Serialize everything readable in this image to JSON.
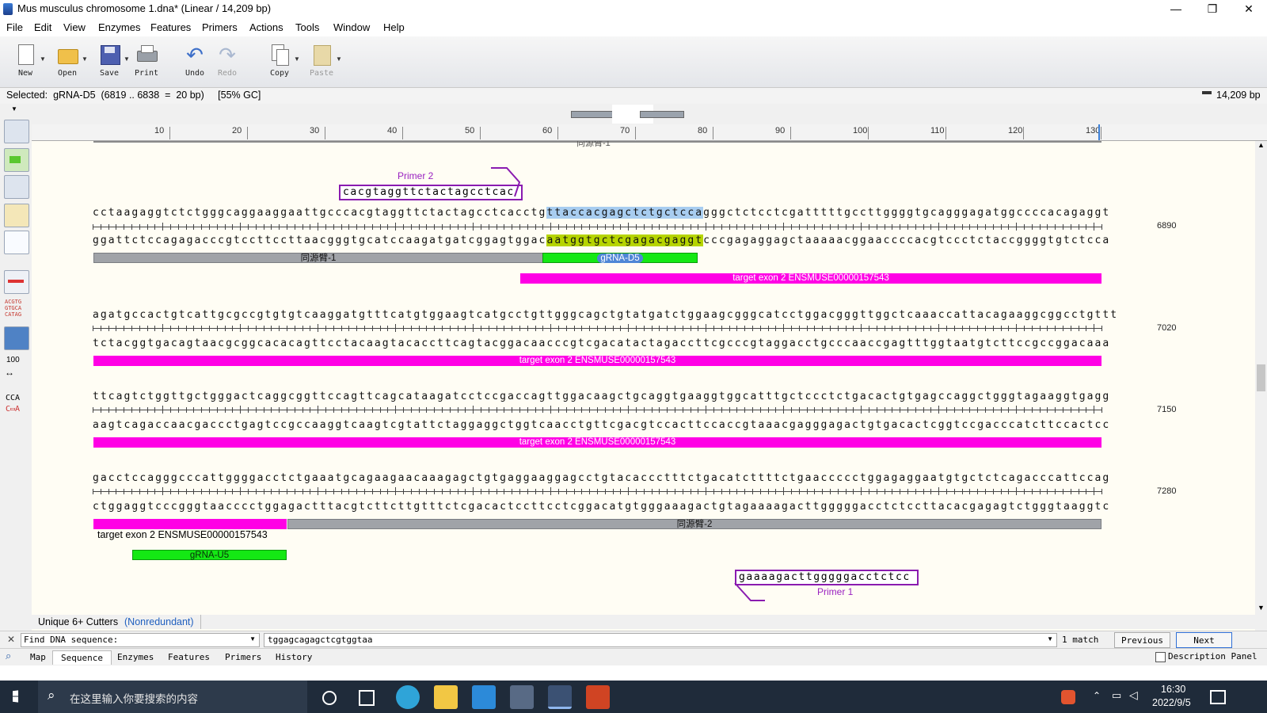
{
  "window": {
    "title": "Mus musculus chromosome 1.dna*  (Linear / 14,209 bp)",
    "minimize": "—",
    "restore": "❐",
    "close": "✕"
  },
  "menu": [
    "File",
    "Edit",
    "View",
    "Enzymes",
    "Features",
    "Primers",
    "Actions",
    "Tools",
    "Window",
    "Help"
  ],
  "toolbar": {
    "new": "New",
    "open": "Open",
    "save": "Save",
    "print": "Print",
    "undo": "Undo",
    "redo": "Redo",
    "copy": "Copy",
    "paste": "Paste"
  },
  "status": {
    "selected": "Selected:  gRNA-D5  (6819 .. 6838  =  20 bp)     [55% GC]",
    "length": "14,209 bp"
  },
  "ruler": {
    "ticks": [
      "10",
      "20",
      "30",
      "40",
      "50",
      "60",
      "70",
      "80",
      "90",
      "100",
      "110",
      "120",
      "130"
    ]
  },
  "sequence": {
    "block1": {
      "top_pre": "cctaagaggtctctgggcaggaaggaattgcccacgtaggttctactagcctcacctg",
      "top_sel": "ttaccacgagctctgctcca",
      "top_post": "gggctctcctcgatttttgccttggggtgcagggagatggccccacagaggt",
      "bot_pre": "ggattctccagagacccgtccttccttaacgggtgcatccaagatgatcggagtggac",
      "bot_sel": "aatggtgctcgagacgaggt",
      "bot_post": "cccgagaggagctaaaaacggaaccccacgtccctctaccggggtgtctcca",
      "number": "6890",
      "primer_top_seq": "cacgtaggttctactagcctcac",
      "primer_top_label": "Primer 2",
      "feat_homology1": "同源臂-1",
      "feat_grna_d5": "gRNA-D5",
      "feat_exon": "target exon 2 ENSMUSE00000157543"
    },
    "block2": {
      "top": "agatgccactgtcattgcgccgtgtgtcaaggatgtttcatgtggaagtcatgcctgttgggcagctgtatgatctggaagcgggcatcctggacgggttggctcaaaccattacagaaggcggcctgttt",
      "bot": "tctacggtgacagtaacgcggcacacagttcctacaagtacaccttcagtacggacaacccgtcgacatactagaccttcgcccgtaggacctgcccaaccgagtttggtaatgtcttccgccggacaaa",
      "number": "7020",
      "feat_exon": "target exon 2 ENSMUSE00000157543"
    },
    "block3": {
      "top": "ttcagtctggttgctgggactcaggcggttccagttcagcataagatcctccgaccagttggacaagctgcaggtgaaggtggcatttgctccctctgacactgtgagccaggctgggtagaaggtgagg",
      "bot": "aagtcagaccaacgaccctgagtccgccaaggtcaagtcgtattctaggaggctggtcaacctgttcgacgtccacttccaccgtaaacgagggagactgtgacactcggtccgacccatcttccactcc",
      "number": "7150",
      "feat_exon": "target exon 2 ENSMUSE00000157543"
    },
    "block4": {
      "top": "gacctccagggcccattggggacctctgaaatgcagaagaacaaagagctgtgaggaaggagcctgtacaccctttctgacatcttttctgaaccccctggagaggaatgtgctctcagacccattccag",
      "bot": "ctggaggtcccgggtaacccctggagactttacgtcttcttgtttctcgacactccttcctcggacatgtgggaaagactgtagaaaagacttgggggacctctccttacacgagagtctgggtaaggtc",
      "number": "7280",
      "feat_exon_label": "target exon 2 ENSMUSE00000157543",
      "feat_homology2": "同源臂-2",
      "feat_grna_u5": "gRNA-U5",
      "primer_bot_seq": "gaaaagacttgggggacctctcc",
      "primer_bot_label": "Primer 1"
    },
    "header_clip": "同源臂-1"
  },
  "cutters": {
    "label": "Unique 6+ Cutters",
    "mode": "(Nonredundant)"
  },
  "find": {
    "mode": "Find DNA sequence:",
    "query": "tggagcagagctcgtggtaa",
    "matches": "1 match",
    "previous": "Previous",
    "next": "Next"
  },
  "tabs": [
    "Map",
    "Sequence",
    "Enzymes",
    "Features",
    "Primers",
    "History"
  ],
  "active_tab": "Sequence",
  "description_panel": "Description Panel",
  "taskbar": {
    "search_placeholder": "在这里输入你要搜索的内容",
    "time": "16:30",
    "date": "2022/9/5"
  },
  "colors": {
    "feature_exon": "#ff00e5",
    "feature_grna": "#14e814",
    "feature_homology": "#a0a3a8",
    "primer": "#8a1bb0",
    "selection": "#a8cdf0",
    "selection_complement": "#b6d400"
  }
}
